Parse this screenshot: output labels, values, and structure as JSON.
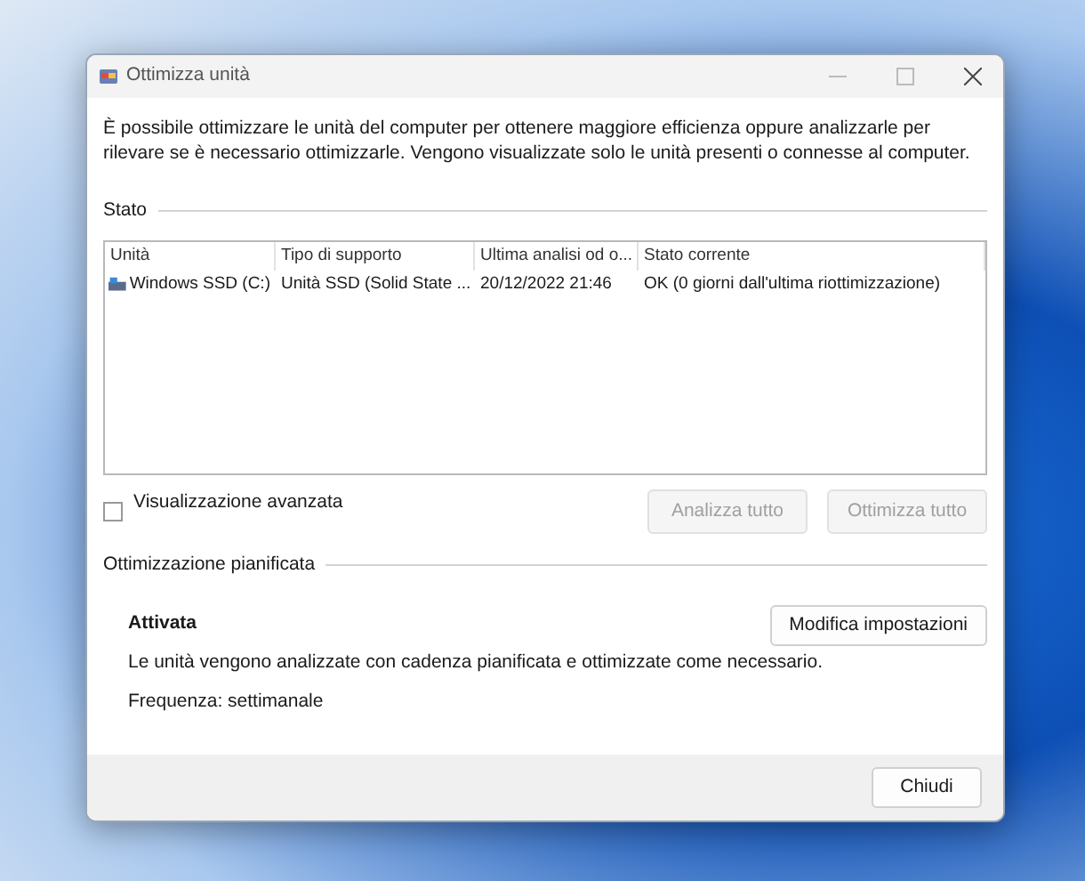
{
  "window": {
    "title": "Ottimizza unità"
  },
  "intro": "È possibile ottimizzare le unità del computer per ottenere maggiore efficienza oppure analizzarle per rilevare se è necessario ottimizzarle. Vengono visualizzate solo le unità presenti o connesse al computer.",
  "status_section": {
    "label": "Stato"
  },
  "table": {
    "columns": [
      "Unità",
      "Tipo di supporto",
      "Ultima analisi od o...",
      "Stato corrente"
    ],
    "rows": [
      {
        "cells": [
          "Windows SSD (C:)",
          "Unità SSD (Solid State ...",
          "20/12/2022 21:46",
          "OK (0 giorni dall'ultima riottimizzazione)"
        ],
        "selected": false
      }
    ]
  },
  "advanced_view": {
    "label": "Visualizzazione avanzata",
    "checked": false
  },
  "actions": [
    {
      "label": "Analizza tutto",
      "disabled": true
    },
    {
      "label": "Ottimizza tutto",
      "disabled": true
    }
  ],
  "scheduled": {
    "label": "Ottimizzazione pianificata",
    "status": "Attivata",
    "description": "Le unità vengono analizzate con cadenza pianificata e ottimizzate come necessario.",
    "frequency": "Frequenza: settimanale",
    "button": "Modifica impostazioni"
  },
  "close_button": "Chiudi"
}
